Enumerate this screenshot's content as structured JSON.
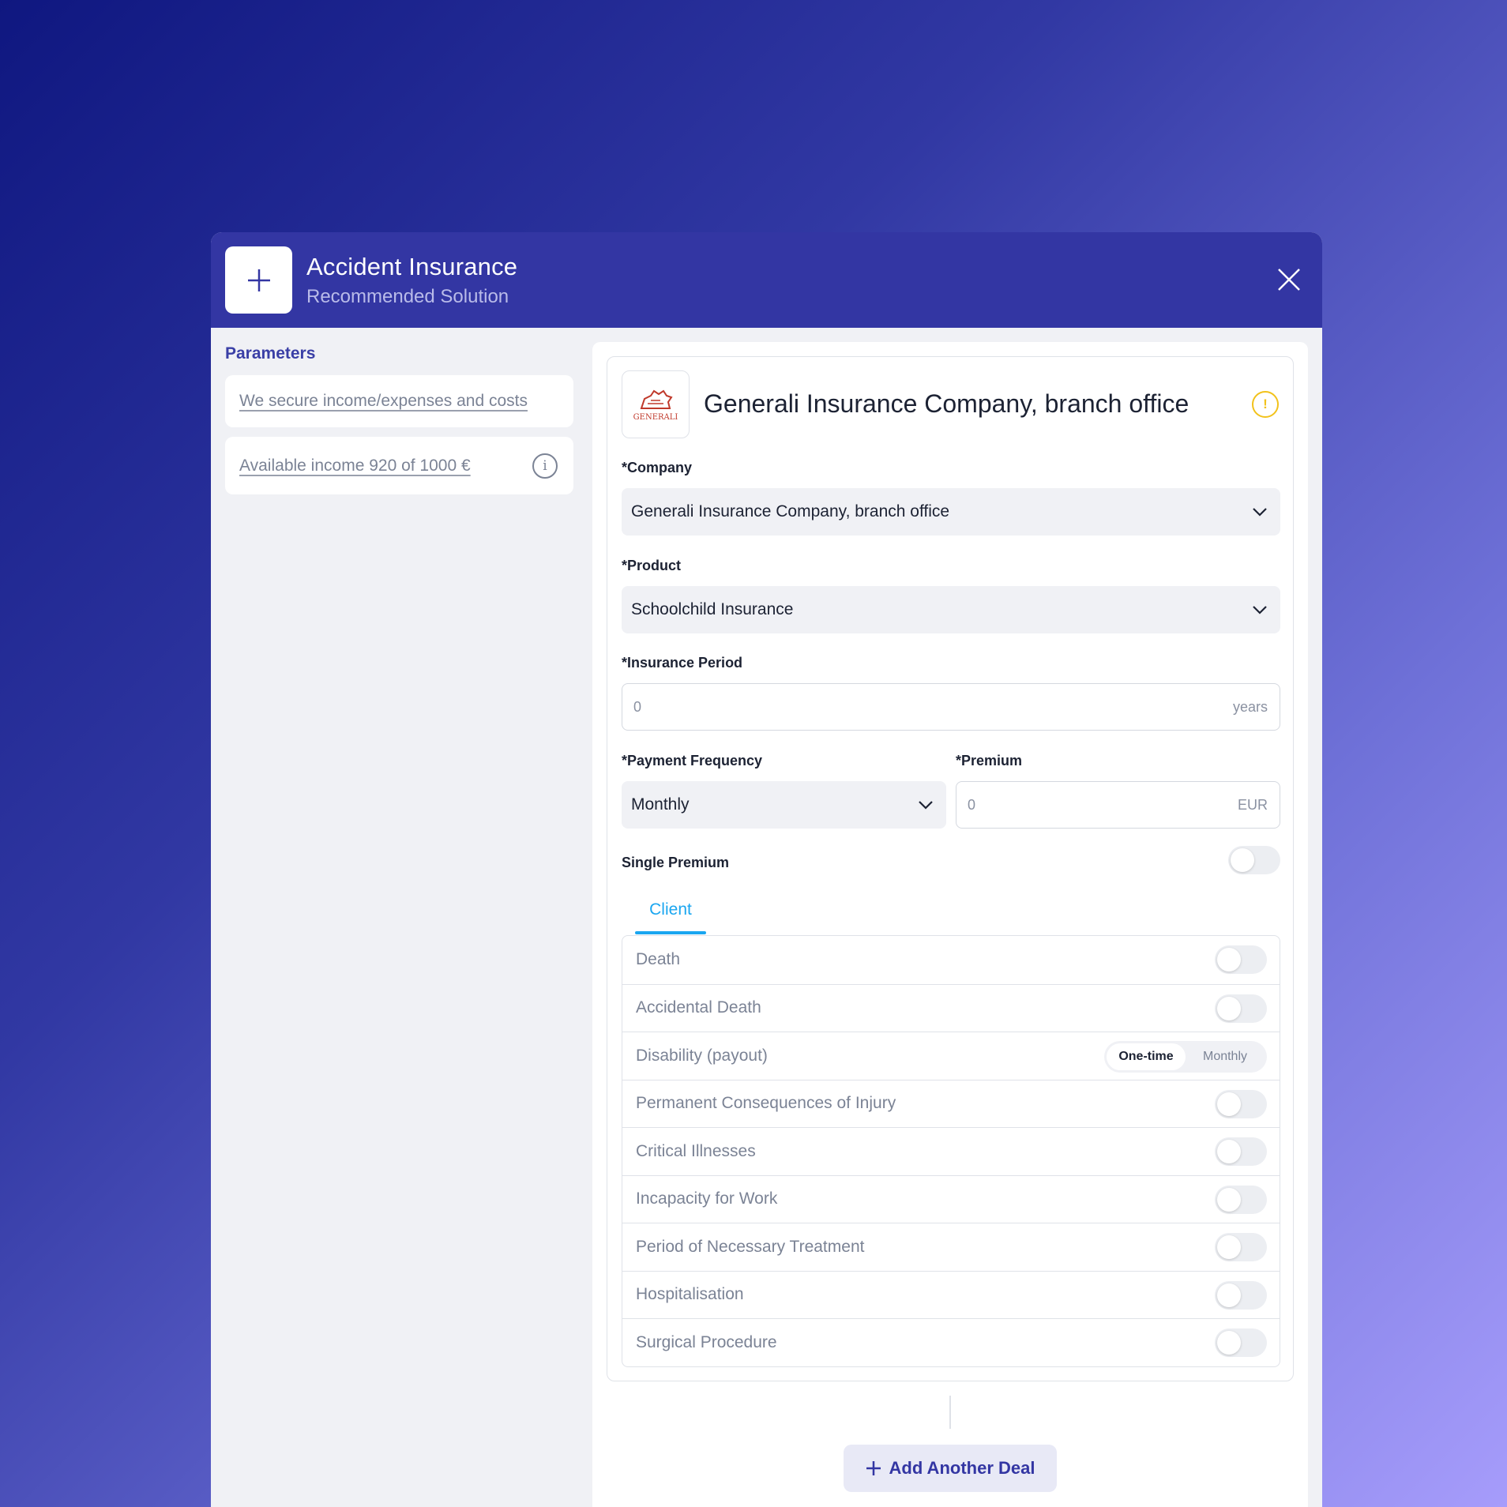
{
  "header": {
    "title": "Accident Insurance",
    "subtitle": "Recommended Solution"
  },
  "parameters": {
    "title": "Parameters",
    "items": [
      {
        "label": "We secure income/expenses and costs"
      },
      {
        "label": "Available income 920 of 1000 €"
      }
    ]
  },
  "deal": {
    "title": "Generali Insurance Company, branch office",
    "logo_text": "GENERALI",
    "company": {
      "label": "*Company",
      "value": "Generali Insurance Company, branch office"
    },
    "product": {
      "label": "*Product",
      "value": "Schoolchild Insurance"
    },
    "insurance_period": {
      "label": "*Insurance Period",
      "value": "0",
      "unit": "years"
    },
    "payment_frequency": {
      "label": "*Payment Frequency",
      "value": "Monthly"
    },
    "premium": {
      "label": "*Premium",
      "value": "0",
      "unit": "EUR"
    },
    "single_premium": {
      "label": "Single Premium",
      "on": false
    },
    "tabs": [
      {
        "label": "Client",
        "active": true
      }
    ],
    "coverages": [
      {
        "label": "Death",
        "on": false
      },
      {
        "label": "Accidental Death",
        "on": false
      },
      {
        "label": "Disability (payout)",
        "options": [
          "One-time",
          "Monthly"
        ],
        "selected": "One-time"
      },
      {
        "label": "Permanent Consequences of Injury",
        "on": false
      },
      {
        "label": "Critical Illnesses",
        "on": false
      },
      {
        "label": "Incapacity for Work",
        "on": false
      },
      {
        "label": "Period of Necessary Treatment",
        "on": false
      },
      {
        "label": "Hospitalisation",
        "on": false
      },
      {
        "label": "Surgical Procedure",
        "on": false
      }
    ]
  },
  "actions": {
    "add_deal": "Add Another Deal"
  },
  "colors": {
    "header_bg": "#3336a3",
    "accent": "#1aa6f0",
    "warning": "#f2c21b",
    "brand_red": "#c0392b"
  }
}
